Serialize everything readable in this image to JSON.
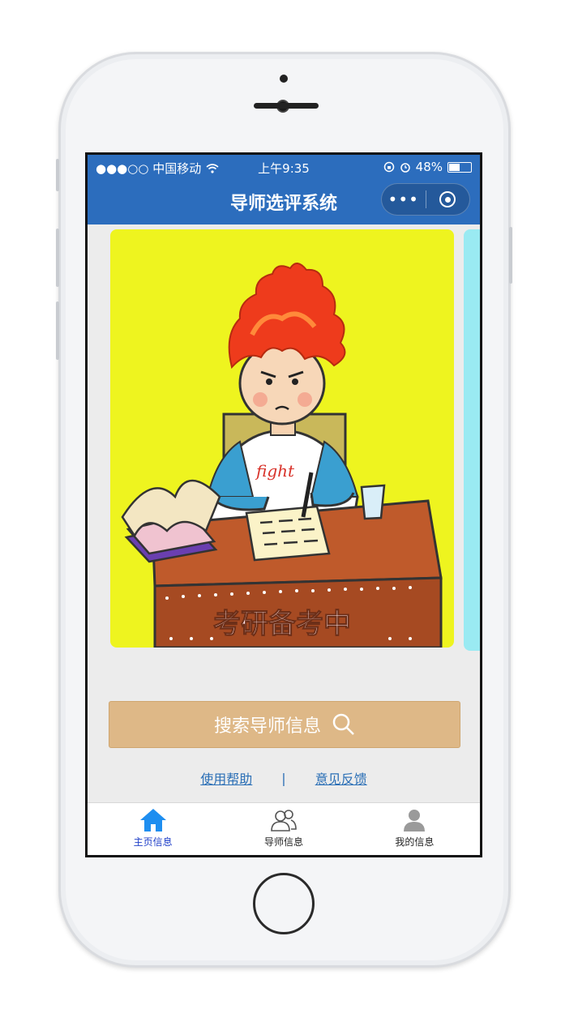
{
  "status": {
    "carrier": "●●●○○ 中国移动",
    "time": "上午9:35",
    "battery": "48%"
  },
  "header": {
    "title": "导师选评系统",
    "more_icon": "more-icon",
    "close_icon": "target-icon"
  },
  "banner": {
    "caption": "考研备考中",
    "shirt_text": "fight"
  },
  "search": {
    "label": "搜索导师信息"
  },
  "links": {
    "help": "使用帮助",
    "separator": "|",
    "feedback": "意见反馈"
  },
  "tabs": [
    {
      "label": "主页信息",
      "icon": "home-icon",
      "active": true
    },
    {
      "label": "导师信息",
      "icon": "group-icon",
      "active": false
    },
    {
      "label": "我的信息",
      "icon": "user-icon",
      "active": false
    }
  ],
  "colors": {
    "nav": "#2c6dbd",
    "search_bg": "#deb887",
    "active_tab": "#1f3fc8"
  }
}
